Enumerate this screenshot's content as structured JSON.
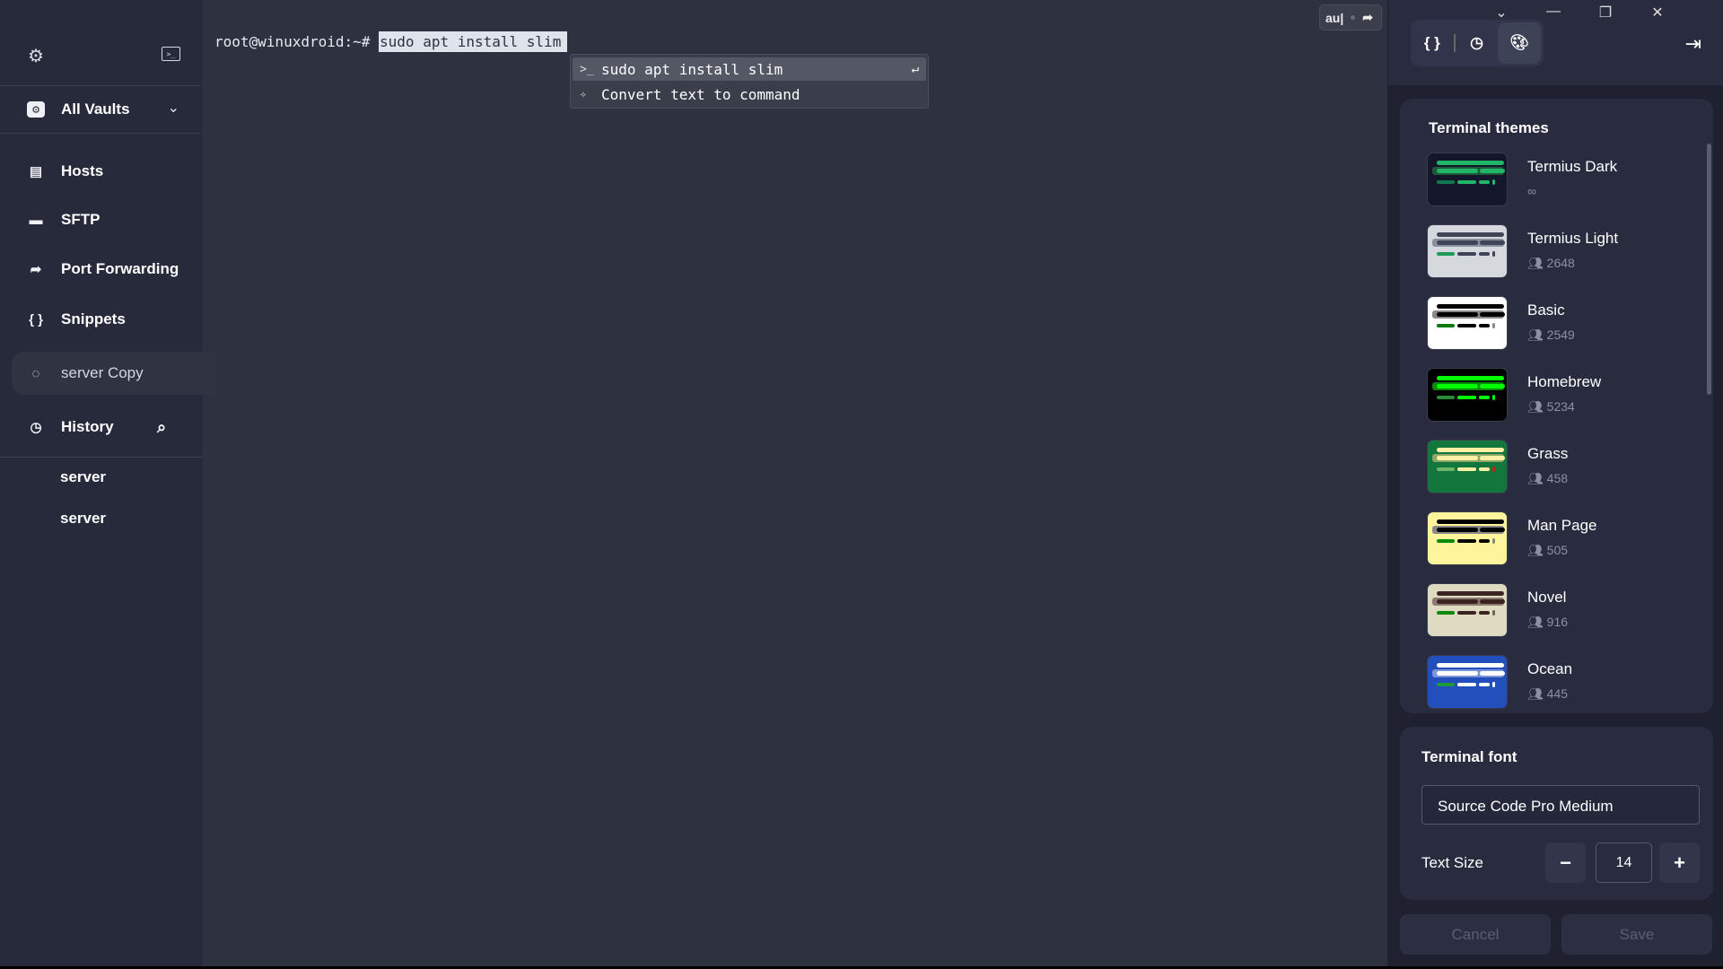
{
  "sidebar": {
    "vault_label": "All Vaults",
    "items": [
      {
        "label": "Hosts",
        "icon": "hosts-icon"
      },
      {
        "label": "SFTP",
        "icon": "folder-icon"
      },
      {
        "label": "Port Forwarding",
        "icon": "port-forwarding-icon"
      },
      {
        "label": "Snippets",
        "icon": "snippets-icon"
      }
    ],
    "active_session": "server Copy",
    "history_label": "History",
    "history_items": [
      "server",
      "server"
    ]
  },
  "terminal": {
    "prompt": "root@winuxdroid:~# ",
    "command": "sudo apt install slim",
    "suggestions": [
      {
        "label": "sudo apt install slim",
        "icon": "terminal-prompt-icon",
        "highlighted": true
      },
      {
        "label": "Convert text to command",
        "icon": "sparkle-icon",
        "highlighted": false
      }
    ],
    "autocomplete_text": "au|"
  },
  "panel": {
    "themes_title": "Terminal themes",
    "themes": [
      {
        "name": "Termius Dark",
        "count": "∞",
        "colors": {
          "bg": "#141729",
          "line": "#21b568",
          "row": "#1e5a3a",
          "small": "#0f7a50",
          "cursor": "#21b568"
        }
      },
      {
        "name": "Termius Light",
        "count": "2648",
        "colors": {
          "bg": "#d5d9de",
          "line": "#3f4459",
          "row": "#8a8f9c",
          "small": "#1f9a57",
          "cursor": "#3f4459"
        }
      },
      {
        "name": "Basic",
        "count": "2549",
        "colors": {
          "bg": "#ffffff",
          "line": "#000000",
          "row": "#888888",
          "small": "#0a7a0a",
          "cursor": "#888888"
        }
      },
      {
        "name": "Homebrew",
        "count": "5234",
        "colors": {
          "bg": "#000000",
          "line": "#00ff00",
          "row": "#0a8a0a",
          "small": "#2a8a3a",
          "cursor": "#00ff00"
        }
      },
      {
        "name": "Grass",
        "count": "458",
        "colors": {
          "bg": "#13773d",
          "line": "#fff0a5",
          "row": "#8fa86a",
          "small": "#6db36a",
          "cursor": "#b52a0a"
        }
      },
      {
        "name": "Man Page",
        "count": "505",
        "colors": {
          "bg": "#fef49c",
          "line": "#000000",
          "row": "#888888",
          "small": "#0a8a0a",
          "cursor": "#888888"
        }
      },
      {
        "name": "Novel",
        "count": "916",
        "colors": {
          "bg": "#dfdbc3",
          "line": "#3b2322",
          "row": "#8a7a70",
          "small": "#0a8a0a",
          "cursor": "#73635a"
        }
      },
      {
        "name": "Ocean",
        "count": "445",
        "colors": {
          "bg": "#224fbc",
          "line": "#ffffff",
          "row": "#7a95d8",
          "small": "#1e9a3a",
          "cursor": "#ffffff"
        }
      }
    ],
    "font_title": "Terminal font",
    "font_value": "Source Code Pro Medium",
    "text_size_label": "Text Size",
    "text_size": "14",
    "minus": "−",
    "plus": "+",
    "cancel": "Cancel",
    "save": "Save"
  }
}
